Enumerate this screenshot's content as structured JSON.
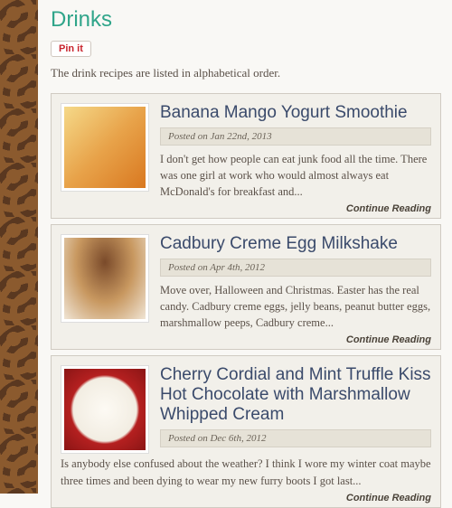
{
  "page": {
    "title": "Drinks",
    "intro": "The drink recipes are listed in alphabetical order."
  },
  "pinit": {
    "label": "Pin it"
  },
  "continue_label": "Continue Reading",
  "posts": [
    {
      "title": "Banana Mango Yogurt Smoothie",
      "date_label": "Posted on Jan 22nd, 2013",
      "excerpt": "I don't get how people can eat junk food all the time. There was one girl at work who would almost always eat McDonald's for breakfast and..."
    },
    {
      "title": "Cadbury Creme Egg Milkshake",
      "date_label": "Posted on Apr 4th, 2012",
      "excerpt": "Move over, Halloween and Christmas. Easter has the real candy. Cadbury creme eggs, jelly beans, peanut butter eggs, marshmallow peeps, Cadbury creme..."
    },
    {
      "title": "Cherry Cordial and Mint Truffle Kiss Hot Chocolate with Marshmallow Whipped Cream",
      "date_label": "Posted on Dec 6th, 2012",
      "excerpt": "Is anybody else confused about the weather? I think I wore my winter coat maybe three times and been dying to wear my new furry boots I got last..."
    }
  ]
}
